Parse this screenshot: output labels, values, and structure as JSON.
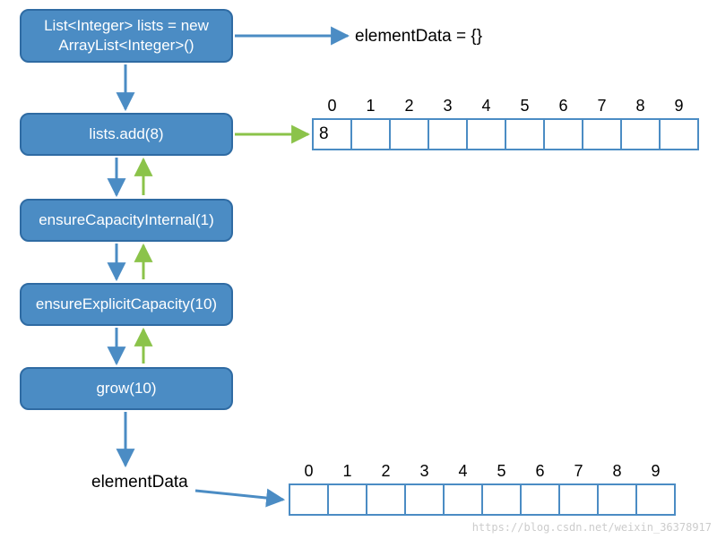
{
  "nodes": {
    "n1": "List<Integer> lists = new\nArrayList<Integer>()",
    "n2": "lists.add(8)",
    "n3": "ensureCapacityInternal(1)",
    "n4": "ensureExplicitCapacity(10)",
    "n5": "grow(10)"
  },
  "labels": {
    "elementDataInit": "elementData = {}",
    "elementDataBottom": "elementData"
  },
  "array1": {
    "indices": [
      "0",
      "1",
      "2",
      "3",
      "4",
      "5",
      "6",
      "7",
      "8",
      "9"
    ],
    "values": [
      "8",
      "",
      "",
      "",
      "",
      "",
      "",
      "",
      "",
      ""
    ]
  },
  "array2": {
    "indices": [
      "0",
      "1",
      "2",
      "3",
      "4",
      "5",
      "6",
      "7",
      "8",
      "9"
    ],
    "values": [
      "",
      "",
      "",
      "",
      "",
      "",
      "",
      "",
      "",
      ""
    ]
  },
  "watermark": "https://blog.csdn.net/weixin_36378917",
  "colors": {
    "node": "#4b8cc4",
    "nodeBorder": "#2f6ba3",
    "blueArrow": "#4b8cc4",
    "greenArrow": "#8bc34a"
  }
}
